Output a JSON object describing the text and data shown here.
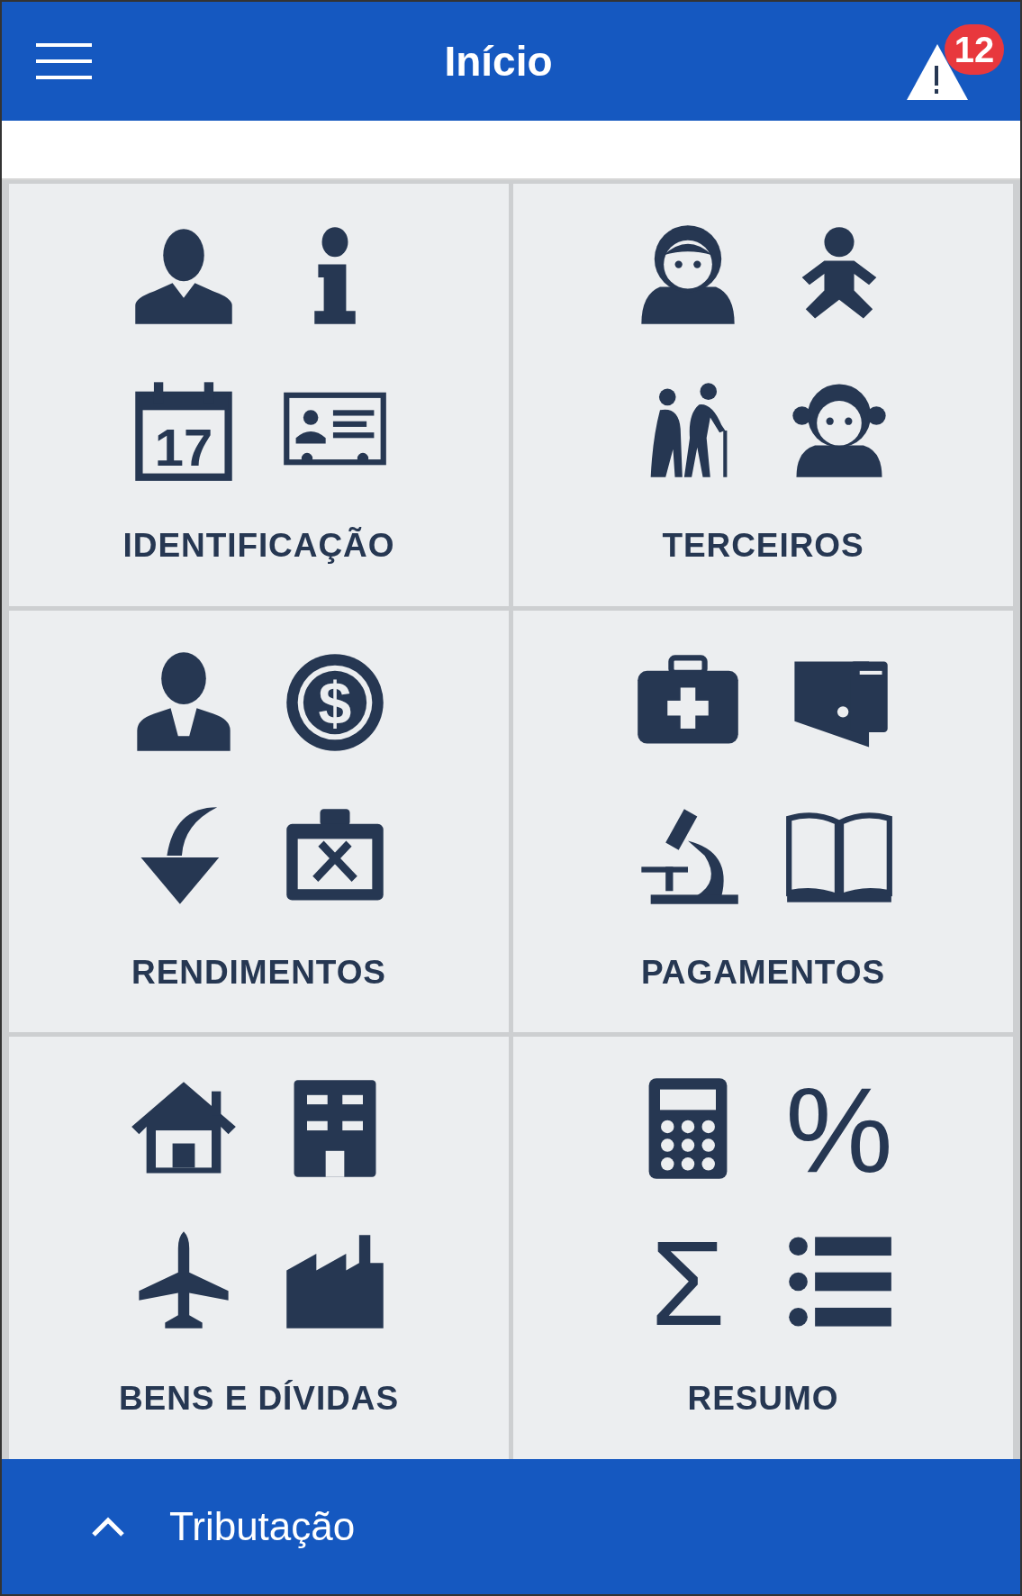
{
  "header": {
    "title": "Início",
    "alert_count": "12"
  },
  "tiles": [
    {
      "label": "IDENTIFICAÇÃO",
      "icons": [
        {
          "kind": "person"
        },
        {
          "kind": "info"
        },
        {
          "kind": "calendar",
          "text": "17"
        },
        {
          "kind": "id-card"
        }
      ]
    },
    {
      "label": "TERCEIROS",
      "icons": [
        {
          "kind": "woman"
        },
        {
          "kind": "baby"
        },
        {
          "kind": "elderly"
        },
        {
          "kind": "girl"
        }
      ]
    },
    {
      "label": "RENDIMENTOS",
      "icons": [
        {
          "kind": "worker"
        },
        {
          "kind": "coin",
          "text": "$"
        },
        {
          "kind": "arrow-down"
        },
        {
          "kind": "toolbox"
        }
      ]
    },
    {
      "label": "PAGAMENTOS",
      "icons": [
        {
          "kind": "medkit"
        },
        {
          "kind": "wallet"
        },
        {
          "kind": "microscope"
        },
        {
          "kind": "book"
        }
      ]
    },
    {
      "label": "BENS E DÍVIDAS",
      "icons": [
        {
          "kind": "house"
        },
        {
          "kind": "building"
        },
        {
          "kind": "airplane"
        },
        {
          "kind": "factory"
        }
      ]
    },
    {
      "label": "RESUMO",
      "icons": [
        {
          "kind": "calculator"
        },
        {
          "kind": "percent",
          "text": "%"
        },
        {
          "kind": "sigma",
          "text": "Σ"
        },
        {
          "kind": "list"
        }
      ]
    }
  ],
  "bottom_bar": {
    "label": "Tributação"
  }
}
